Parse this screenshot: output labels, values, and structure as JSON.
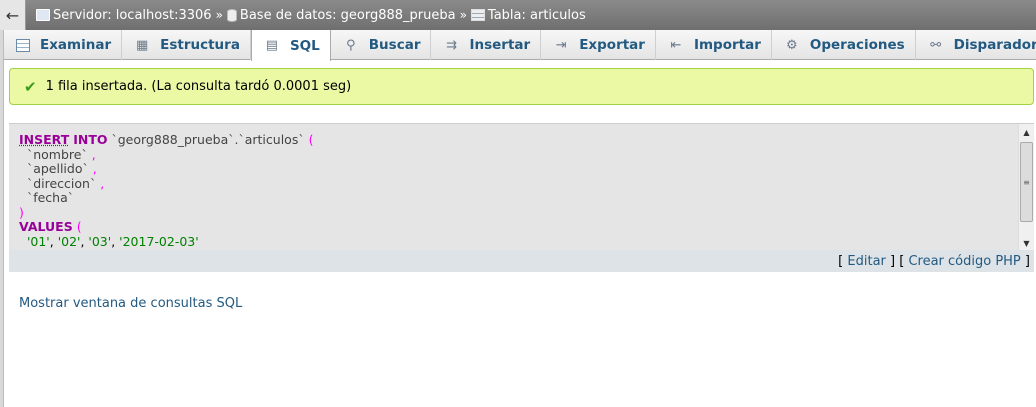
{
  "breadcrumb": {
    "back": "←",
    "server": "Servidor: localhost:3306",
    "database": "Base de datos: georg888_prueba",
    "table": "Tabla: articulos",
    "separator": "»"
  },
  "tabs": [
    {
      "label": "Examinar",
      "icon": "browse-icon"
    },
    {
      "label": "Estructura",
      "icon": "structure-icon"
    },
    {
      "label": "SQL",
      "icon": "sql-icon",
      "active": true
    },
    {
      "label": "Buscar",
      "icon": "search-icon"
    },
    {
      "label": "Insertar",
      "icon": "insert-icon"
    },
    {
      "label": "Exportar",
      "icon": "export-icon"
    },
    {
      "label": "Importar",
      "icon": "import-icon"
    },
    {
      "label": "Operaciones",
      "icon": "wrench-icon"
    },
    {
      "label": "Disparadores",
      "icon": "triggers-icon"
    }
  ],
  "message": {
    "text": "1 fila insertada. (La consulta tardó 0.0001 seg)"
  },
  "sql": {
    "kw_insert": "INSERT",
    "kw_into": "INTO",
    "table_ref": "`georg888_prueba`.`articulos`",
    "columns": [
      "`nombre`",
      "`apellido`",
      "`direccion`",
      "`fecha`"
    ],
    "kw_values": "VALUES",
    "values": [
      "'01'",
      "'02'",
      "'03'",
      "'2017-02-03'"
    ]
  },
  "sql_footer": {
    "edit": "Editar",
    "php": "Crear código PHP"
  },
  "show_query_window": "Mostrar ventana de consultas SQL",
  "colors": {
    "link": "#235a81",
    "success_bg": "#ebf8a4",
    "keyword": "#990099",
    "punct": "#ff00ff"
  }
}
